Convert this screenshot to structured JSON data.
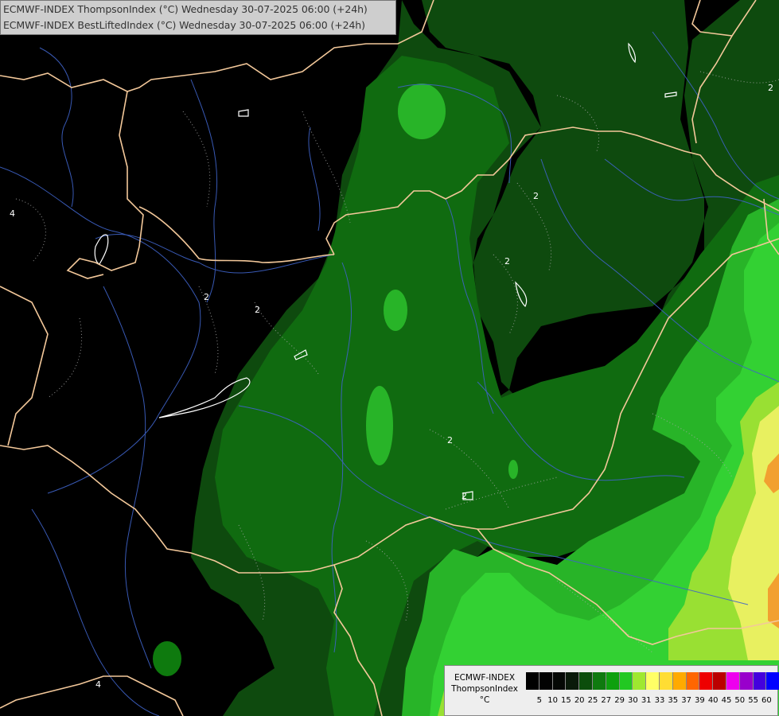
{
  "header": {
    "line1": "ECMWF-INDEX ThompsonIndex (°C) Wednesday 30-07-2025 06:00 (+24h)",
    "line2": "ECMWF-INDEX BestLiftedIndex (°C) Wednesday 30-07-2025 06:00 (+24h)"
  },
  "legend": {
    "model": "ECMWF-INDEX",
    "parameter": "ThompsonIndex",
    "unit": "°C",
    "ticks": [
      "5",
      "10",
      "15",
      "20",
      "25",
      "27",
      "29",
      "30",
      "31",
      "33",
      "35",
      "37",
      "39",
      "40",
      "45",
      "50",
      "55",
      "60"
    ],
    "colors": [
      "#000000",
      "#020202",
      "#050805",
      "#0a1a0a",
      "#0b4d0b",
      "#0f7a0f",
      "#0ea00e",
      "#22c822",
      "#9fe830",
      "#ffff66",
      "#ffdd33",
      "#ffaa00",
      "#ff6600",
      "#ee0000",
      "#bb0000",
      "#ee00ee",
      "#9900cc",
      "#4400dd",
      "#0000ff"
    ]
  },
  "map": {
    "contour_labels": [
      "2",
      "2",
      "2",
      "2",
      "2",
      "2",
      "2",
      "4",
      "4"
    ],
    "colors": {
      "background": "#000000",
      "dark_green": "#0e4a0e",
      "mid_green": "#106b10",
      "bright_green": "#28b428",
      "light_green": "#33d133",
      "lime": "#99e033",
      "yellow": "#e8f060",
      "orange": "#f2a030",
      "border": "#f3c89a",
      "river": "#3f63c8",
      "contour": "#ffffff"
    }
  }
}
